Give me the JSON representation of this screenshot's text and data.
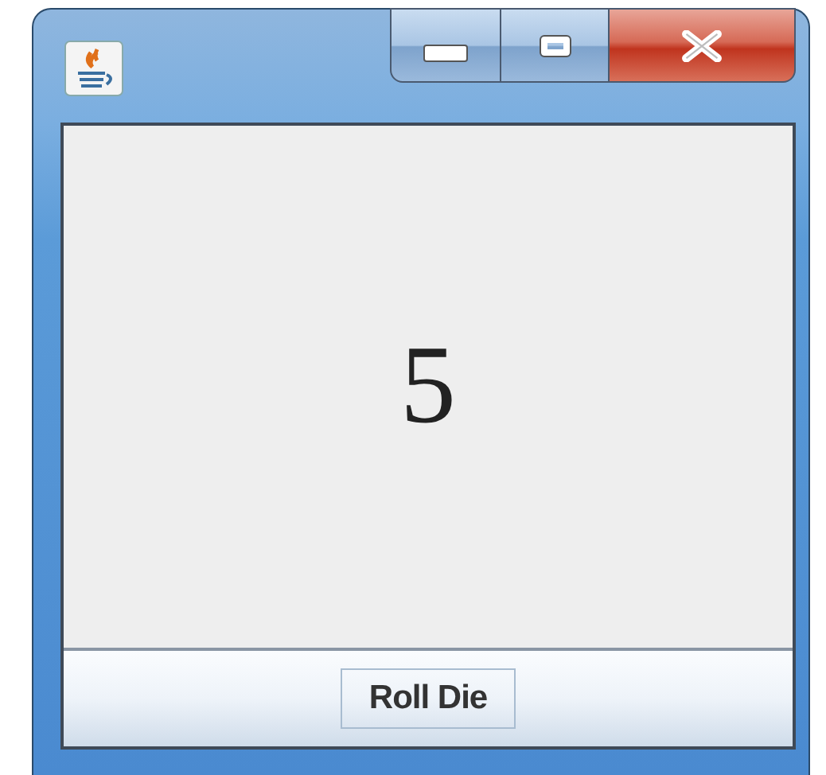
{
  "display": {
    "value": "5"
  },
  "button": {
    "label": "Roll Die",
    "focused": true
  }
}
